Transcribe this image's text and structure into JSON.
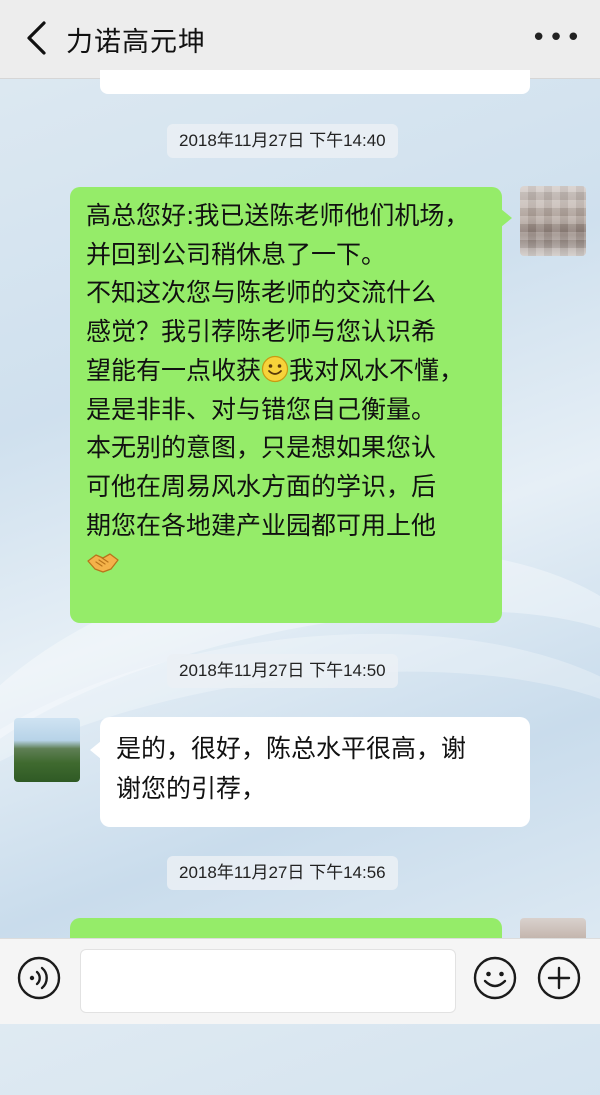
{
  "header": {
    "title": "力诺高元坤",
    "back_icon": "chevron-left-icon",
    "more_label": "•••"
  },
  "messages": [
    {
      "type": "timestamp",
      "text": "2018年11月27日 下午14:40"
    },
    {
      "type": "outgoing",
      "lines": [
        "高总您好:我已送陈老师他们机场，",
        "并回到公司稍休息了一下。",
        "不知这次您与陈老师的交流什么",
        "感觉？我引荐陈老师与您认识希",
        "望能有一点收获",
        "我对风水不懂，",
        "是是非非、对与错您自己衡量。",
        "本无别的意图，只是想如果您认",
        "可他在周易风水方面的学识，后",
        "期您在各地建产业园都可用上他"
      ],
      "emojis": [
        "smile-emoji",
        "handshake-emoji"
      ]
    },
    {
      "type": "timestamp",
      "text": "2018年11月27日 下午14:50"
    },
    {
      "type": "incoming",
      "lines": [
        "是的，很好，陈总水平很高，谢",
        "谢您的引荐，"
      ]
    },
    {
      "type": "timestamp",
      "text": "2018年11月27日 下午14:56"
    }
  ],
  "input_bar": {
    "voice_icon": "voice-icon",
    "emoji_icon": "emoji-icon",
    "plus_icon": "plus-icon",
    "input_value": ""
  },
  "colors": {
    "outgoing_bubble": "#95ec69",
    "incoming_bubble": "#ffffff",
    "top_bar": "#ededed"
  }
}
